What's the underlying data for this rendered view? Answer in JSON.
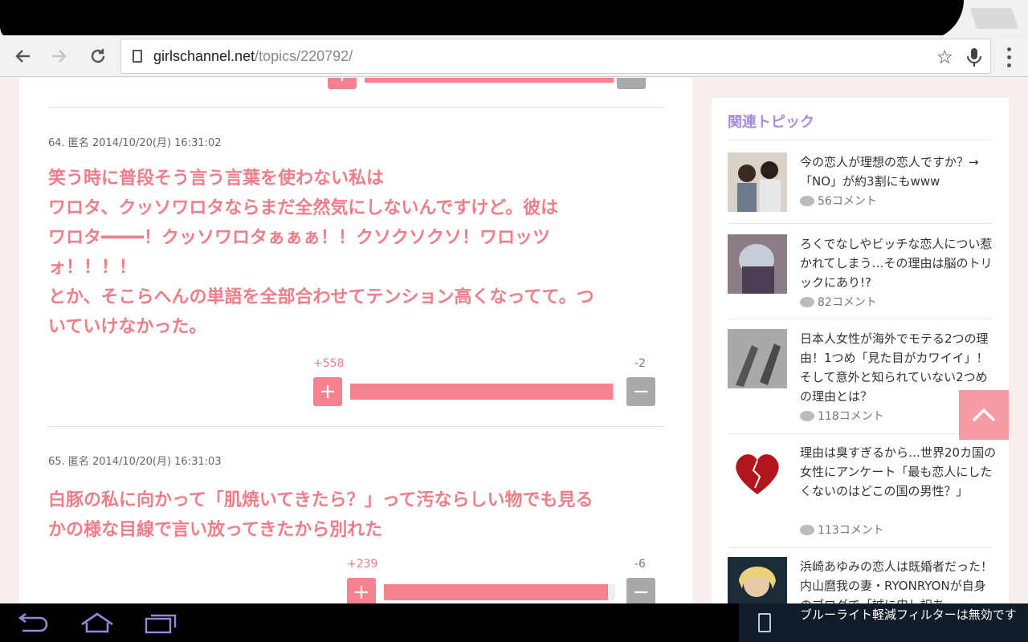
{
  "browser": {
    "url_host": "girlschannel.net",
    "url_path": "/topics/220792/"
  },
  "comments": [
    {
      "meta": "64. 匿名 2014/10/20(月) 16:31:02",
      "lines": [
        "笑う時に普段そう言う言葉を使わない私は",
        "ワロタ、クッソワロタならまだ全然気にしないんですけど。彼は",
        "ワロタ━━━━！クッソワロタぁぁぁ！！クソクソクソ！ワロッツ",
        "ォ！！！！",
        "とか、そこらへんの単語を全部合わせてテンション高くなってて。つ",
        "いていけなかった。"
      ],
      "plus": "+558",
      "minus": "-2",
      "plus_ratio": 0.99
    },
    {
      "meta": "65. 匿名 2014/10/20(月) 16:31:03",
      "lines": [
        "白豚の私に向かって「肌焼いてきたら？」って汚ならしい物でも見る",
        "かの様な目線で言い放ってきたから別れた"
      ],
      "plus": "+239",
      "minus": "-6",
      "plus_ratio": 0.97
    }
  ],
  "sidebar": {
    "title": "関連トピック",
    "items": [
      {
        "title": "今の恋人が理想の恋人ですか？→「NO」が約3割にもwww",
        "count": "56コメント"
      },
      {
        "title": "ろくでなしやビッチな恋人につい惹かれてしまう…その理由は脳のトリックにあり!?",
        "count": "82コメント"
      },
      {
        "title": "日本人女性が海外でモテる2つの理由！1つめ「見た目がカワイイ」！そして意外と知られていない2つめの理由とは？",
        "count": "118コメント"
      },
      {
        "title": "理由は臭すぎるから…世界20カ国の女性にアンケート「最も恋人にしたくないのはどこの国の男性？」",
        "count": "113コメント"
      },
      {
        "title": "浜崎あゆみの恋人は既婚者だった！内山麿我の妻・RYONRYONが自身のブログで「誠に申し訳あ",
        "count": ""
      }
    ]
  },
  "system": {
    "notification": "ブルーライト軽減フィルターは無効です"
  },
  "colors": {
    "accent_pink": "#f07d88",
    "sidebar_title": "#a48ed8"
  }
}
